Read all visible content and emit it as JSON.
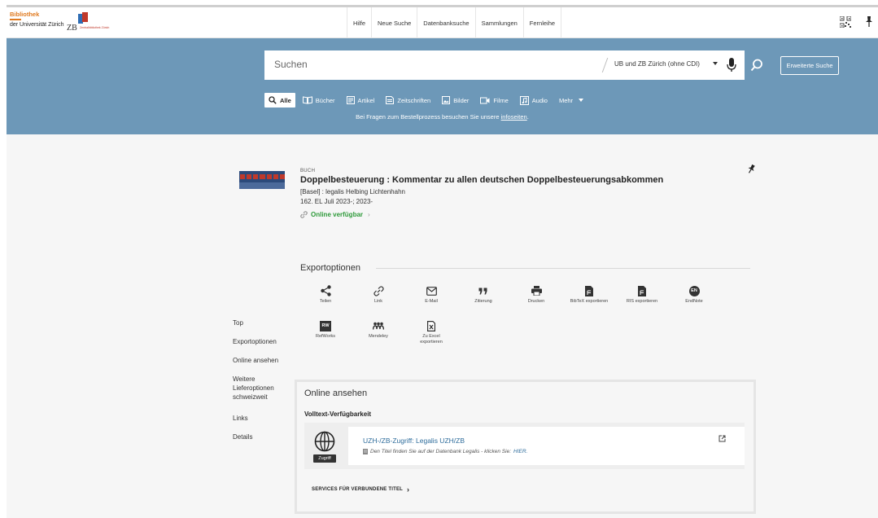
{
  "logo": {
    "ub_line1": "Bibliothek",
    "ub_line2": "der Universität Zürich",
    "zb": "ZB",
    "zb_sub": "Zentralbibliothek Zürich"
  },
  "topnav": [
    "Hilfe",
    "Neue Suche",
    "Datenbanksuche",
    "Sammlungen",
    "Fernleihe"
  ],
  "search": {
    "placeholder": "Suchen",
    "scope": "UB und ZB Zürich (ohne CDI)",
    "advanced": "Erweiterte Suche"
  },
  "media_types": [
    {
      "label": "Alle",
      "icon": "search-icon",
      "active": true
    },
    {
      "label": "Bücher",
      "icon": "books-icon"
    },
    {
      "label": "Artikel",
      "icon": "article-icon"
    },
    {
      "label": "Zeitschriften",
      "icon": "journal-icon"
    },
    {
      "label": "Bilder",
      "icon": "image-icon"
    },
    {
      "label": "Filme",
      "icon": "video-icon"
    },
    {
      "label": "Audio",
      "icon": "audio-icon"
    },
    {
      "label": "Mehr",
      "icon": "chevron-down-icon"
    }
  ],
  "notice": {
    "text": "Bei Fragen zum Bestellprozess besuchen Sie unsere ",
    "link": "infoseiten",
    "end": "."
  },
  "record": {
    "type": "BUCH",
    "title": "Doppelbesteuerung : Kommentar zu allen deutschen Doppelbesteuerungsabkommen",
    "publisher": "[Basel] : legalis Helbing Lichtenhahn",
    "edition": "162. EL Juli 2023-; 2023-",
    "availability": "Online verfügbar",
    "avail_chevron": "›"
  },
  "export": {
    "heading": "Exportoptionen",
    "items": [
      {
        "label": "Teilen",
        "icon": "share-icon"
      },
      {
        "label": "Link",
        "icon": "link-icon"
      },
      {
        "label": "E-Mail",
        "icon": "mail-icon"
      },
      {
        "label": "Zitierung",
        "icon": "quote-icon"
      },
      {
        "label": "Drucken",
        "icon": "print-icon"
      },
      {
        "label": "BibTeX exportieren",
        "icon": "bibtex-file-icon"
      },
      {
        "label": "RIS exportieren",
        "icon": "ris-file-icon"
      },
      {
        "label": "EndNote",
        "icon": "endnote-icon",
        "badge": "EN"
      },
      {
        "label": "RefWorks",
        "icon": "refworks-icon",
        "badge": "RW"
      },
      {
        "label": "Mendeley",
        "icon": "mendeley-icon"
      },
      {
        "label": "Zu Excel exportieren",
        "icon": "excel-file-icon"
      }
    ]
  },
  "left_nav": [
    "Top",
    "Exportoptionen",
    "Online ansehen",
    "Weitere Lieferoptionen schweizweit",
    "Links",
    "Details"
  ],
  "online": {
    "heading": "Online ansehen",
    "subheading": "Volltext-Verfügbarkeit",
    "access_badge": "Zugriff",
    "link_title": "UZH-/ZB-Zugriff: Legalis UZH/ZB",
    "note": "Den Titel finden Sie auf der Datenbank Legalis - klicken Sie:",
    "note_link": "HIER.",
    "services": "SERVICES FÜR VERBUNDENE TITEL"
  },
  "colors": {
    "band": "#6d98b8",
    "available_green": "#2e9a3a",
    "link_blue": "#2f6d9c",
    "brand_orange": "#e07a1f"
  }
}
